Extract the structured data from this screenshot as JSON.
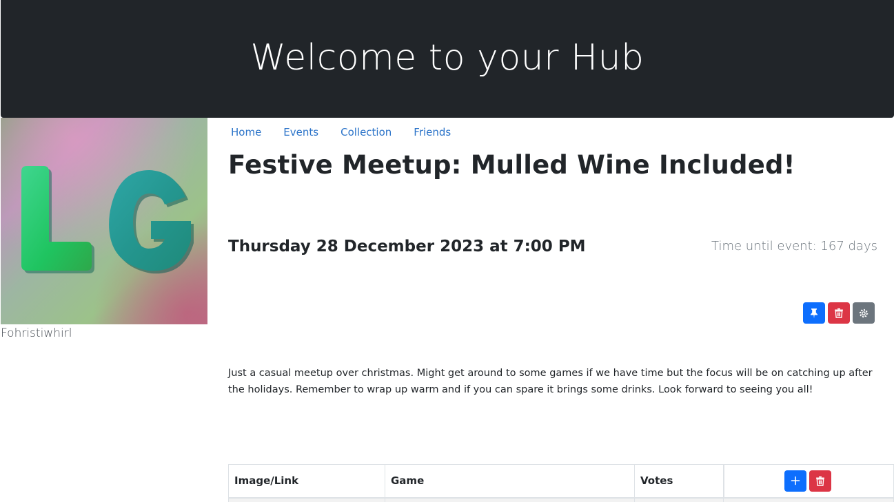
{
  "header": {
    "title": "Welcome to your Hub"
  },
  "profile": {
    "avatar_initials": "LG",
    "username": "Fohristiwhirl"
  },
  "nav": {
    "items": [
      {
        "label": "Home"
      },
      {
        "label": "Events"
      },
      {
        "label": "Collection"
      },
      {
        "label": "Friends"
      }
    ]
  },
  "event": {
    "title": "Festive Meetup: Mulled Wine Included!",
    "date": "Thursday 28 December 2023 at 7:00 PM",
    "countdown": "Time until event: 167 days",
    "description": "Just a casual meetup over christmas. Might get around to some games if we have time but the focus will be on catching up after the holidays. Remember to wrap up warm and if you can spare it brings some drinks. Look forward to seeing you all!",
    "actions": [
      {
        "icon": "pin-icon",
        "color": "#0d6efd"
      },
      {
        "icon": "trash-icon",
        "color": "#dc3545"
      },
      {
        "icon": "gear-icon",
        "color": "#6c757d"
      }
    ]
  },
  "games_table": {
    "columns": [
      "Image/Link",
      "Game",
      "Votes"
    ],
    "actions": [
      {
        "icon": "plus-icon",
        "color": "#0d6efd"
      },
      {
        "icon": "trash-icon",
        "color": "#dc3545"
      }
    ]
  },
  "colors": {
    "header_bg": "#212529",
    "link": "#2c74c9",
    "primary": "#0d6efd",
    "danger": "#dc3545",
    "secondary": "#6c757d"
  }
}
